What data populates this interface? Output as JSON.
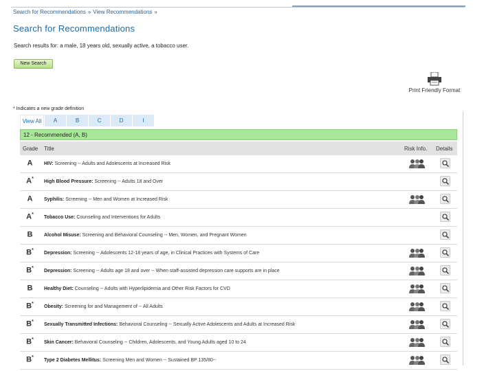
{
  "breadcrumb": {
    "items": [
      "Search for Recommendations",
      "View Recommendations"
    ],
    "separator": "»"
  },
  "page_title": "Search for Recommendations",
  "search_summary": "Search results for: a male, 18 years old, sexually active, a tobacco user.",
  "new_search_label": "New Search",
  "print_label": "Print Friendly Format",
  "new_grade_note": "* Indicates a new grade definition",
  "tabs": [
    "View All",
    "A",
    "B",
    "C",
    "D",
    "I"
  ],
  "group_header": "12 - Recommended (A, B)",
  "columns": {
    "grade": "Grade",
    "title": "Title",
    "risk": "Risk Info.",
    "details": "Details"
  },
  "rows": [
    {
      "grade": "A",
      "star": "",
      "topic": "HIV:",
      "text": " Screening -- Adults and Adolescents at Increased Risk",
      "risk": true
    },
    {
      "grade": "A",
      "star": "*",
      "topic": "High Blood Pressure:",
      "text": " Screening -- Adults 18 and Over",
      "risk": false
    },
    {
      "grade": "A",
      "star": "",
      "topic": "Syphilis:",
      "text": " Screening -- Men and Women at Increased Risk",
      "risk": true
    },
    {
      "grade": "A",
      "star": "*",
      "topic": "Tobacco Use:",
      "text": " Counseling and Interventions for Adults",
      "risk": false
    },
    {
      "grade": "B",
      "star": "",
      "topic": "Alcohol Misuse:",
      "text": " Screening and Behavioral Counseling -- Men, Women, and Pregnant Women",
      "risk": false
    },
    {
      "grade": "B",
      "star": "*",
      "topic": "Depression:",
      "text": " Screening -- Adolescents 12-18 years of age, in Clinical Practices with Systems of Care",
      "risk": true
    },
    {
      "grade": "B",
      "star": "*",
      "topic": "Depression:",
      "text": " Screening -- Adults age 18 and over -- When staff-assisted depression care supports are in place",
      "risk": true
    },
    {
      "grade": "B",
      "star": "",
      "topic": "Healthy Diet:",
      "text": " Counseling -- Adults with Hyperlipidemia and Other Risk Factors for CVD",
      "risk": true
    },
    {
      "grade": "B",
      "star": "*",
      "topic": "Obesity:",
      "text": " Screening for and Management of -- All Adults",
      "risk": true
    },
    {
      "grade": "B",
      "star": "*",
      "topic": "Sexually Transmitted Infections:",
      "text": " Behavioral Counseling -- Sexually Active Adolescents and Adults at Increased Risk",
      "risk": true
    },
    {
      "grade": "B",
      "star": "*",
      "topic": "Skin Cancer:",
      "text": " Behavioral Counseling -- Children, Adolescents, and Young Adults aged 10 to 24",
      "risk": true
    },
    {
      "grade": "B",
      "star": "*",
      "topic": "Type 2 Diabetes Mellitus:",
      "text": " Screening Men and Women -- Sustained BP 135/80--",
      "risk": true
    }
  ],
  "colors": {
    "title_blue": "#1b6aa8",
    "group_green": "#a8e79a",
    "button_green": "#b6e08a"
  },
  "icons": {
    "risk": "people-icon",
    "details": "magnifier-icon",
    "print": "printer-icon"
  }
}
